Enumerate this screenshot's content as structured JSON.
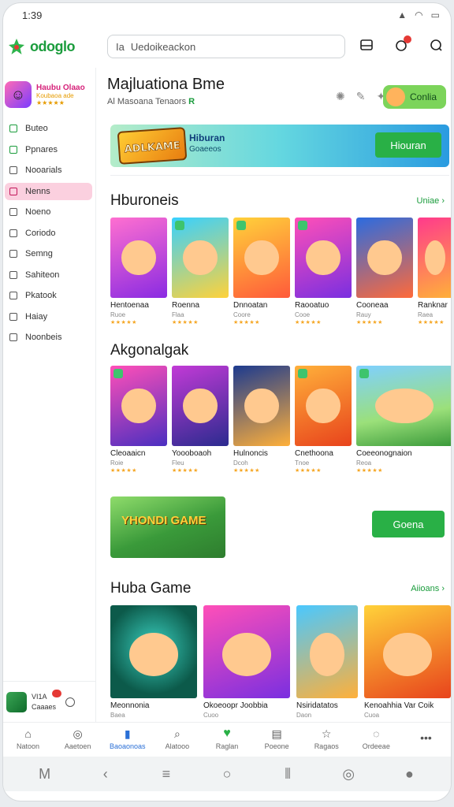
{
  "status": {
    "time": "1:39"
  },
  "app": {
    "logo_text": "odoglo"
  },
  "search": {
    "prefix": "Ia",
    "value": "Uedoikeackon"
  },
  "sidebar": {
    "profile_name": "Haubu Olaao",
    "profile_sub": "Koubaoa ade",
    "profile_stars": "★★★★★",
    "items": [
      {
        "label": "Buteo"
      },
      {
        "label": "Ppnares"
      },
      {
        "label": "Nooarials"
      },
      {
        "label": "Nenns"
      },
      {
        "label": "Noeno"
      },
      {
        "label": "Coriodo"
      },
      {
        "label": "Semng"
      },
      {
        "label": "Sahiteon"
      },
      {
        "label": "Pkatook"
      },
      {
        "label": "Haiay"
      },
      {
        "label": "Noonbeis"
      }
    ],
    "user_name": "VI1A",
    "user_sub": "Caaaes"
  },
  "feature": {
    "title": "Majluationa Bme",
    "subtitle": "Al Masoana Tenaors",
    "subtitle_mark": "R",
    "chip_label": "Conlia"
  },
  "banner": {
    "logo_text": "ADLKAME",
    "title": "Hiburan",
    "subtitle": "Goaeeos",
    "button": "Hiouran"
  },
  "sections": [
    {
      "title": "Hburoneis",
      "see_more": "Uniae",
      "cards": [
        {
          "title": "Hentoenaa",
          "sub": "Ruoe",
          "stars": "★★★★★"
        },
        {
          "title": "Roenna",
          "sub": "Flaa",
          "stars": "★★★★★"
        },
        {
          "title": "Dnnoatan",
          "sub": "Coore",
          "stars": "★★★★★"
        },
        {
          "title": "Raooatuo",
          "sub": "Cooe",
          "stars": "★★★★★"
        },
        {
          "title": "Cooneaa",
          "sub": "Rauy",
          "stars": "★★★★★"
        },
        {
          "title": "Ranknar",
          "sub": "Raea",
          "stars": "★★★★★"
        }
      ]
    },
    {
      "title": "Akgonalgak",
      "cards": [
        {
          "title": "Cleoaaicn",
          "sub": "Roie",
          "stars": "★★★★★"
        },
        {
          "title": "Yoooboaoh",
          "sub": "Fleu",
          "stars": "★★★★★"
        },
        {
          "title": "Hulnoncis",
          "sub": "Dcoh",
          "stars": "★★★★★"
        },
        {
          "title": "Cnethoona",
          "sub": "Tnoe",
          "stars": "★★★★★"
        },
        {
          "title": "Coeeonognaion",
          "sub": "Reoa",
          "stars": "★★★★★"
        }
      ]
    },
    {
      "title": "Huba Game",
      "see_more": "Aiioans",
      "cards": [
        {
          "title": "Meonnonia",
          "sub": "Baea"
        },
        {
          "title": "Okoeoopr Joobbia",
          "sub": "Cuoo"
        },
        {
          "title": "Nsiridatatos",
          "sub": "Daon"
        },
        {
          "title": "Kenoahhia Var Coik",
          "sub": "Cuoa"
        }
      ]
    }
  ],
  "promo": {
    "image_text": "YHONDI GAME",
    "button": "Goena"
  },
  "bottom_nav": [
    {
      "label": "Natoon",
      "icon": "home-icon",
      "glyph": "⌂"
    },
    {
      "label": "Aaetoen",
      "icon": "gamepad-icon",
      "glyph": "◎"
    },
    {
      "label": "Baoaonoas",
      "icon": "bookmark-icon",
      "glyph": "▮"
    },
    {
      "label": "Alatooo",
      "icon": "search-icon",
      "glyph": "⌕"
    },
    {
      "label": "Raglan",
      "icon": "heart-icon",
      "glyph": "♥"
    },
    {
      "label": "Poeone",
      "icon": "document-icon",
      "glyph": "▤"
    },
    {
      "label": "Ragaos",
      "icon": "star-icon",
      "glyph": "☆"
    },
    {
      "label": "Ordeeae",
      "icon": "chat-icon",
      "glyph": "◌"
    },
    {
      "label": "",
      "icon": "more-icon",
      "glyph": "•••"
    }
  ],
  "colors": {
    "accent": "#29b046",
    "active_nav": "#fbd0df",
    "link": "#2a6fd6"
  }
}
